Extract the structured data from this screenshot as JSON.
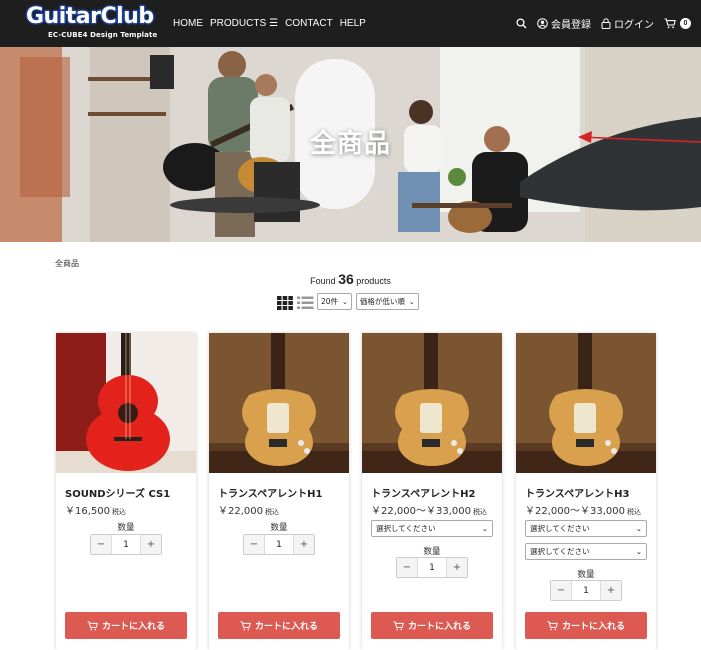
{
  "header": {
    "logo_main": "GuitarClub",
    "logo_sub": "EC-CUBE4 Design Template",
    "nav": [
      {
        "label": "HOME"
      },
      {
        "label": "PRODUCTS"
      },
      {
        "label": "CONTACT"
      },
      {
        "label": "HELP"
      }
    ],
    "register_label": "会員登録",
    "login_label": "ログイン",
    "cart_count": "0",
    "icons": {
      "search": "search-icon",
      "user": "user-icon",
      "lock": "lock-icon",
      "cart": "cart-icon",
      "menu": "hamburger-icon"
    }
  },
  "hero": {
    "title": "全商品"
  },
  "breadcrumb": "全商品",
  "results": {
    "prefix": "Found",
    "count": "36",
    "suffix": "products",
    "per_page": "20件",
    "sort": "価格が低い順"
  },
  "products": [
    {
      "name": "SOUNDシリーズ CS1",
      "price": "￥16,500",
      "tax": "税込",
      "options": [],
      "qty_label": "数量",
      "qty": "1",
      "cart_label": "カートに入れる",
      "image": "red-acoustic-guitar"
    },
    {
      "name": "トランスペアレントH1",
      "price": "￥22,000",
      "tax": "税込",
      "options": [],
      "qty_label": "数量",
      "qty": "1",
      "cart_label": "カートに入れる",
      "image": "bass-guitar"
    },
    {
      "name": "トランスペアレントH2",
      "price": "￥22,000～￥33,000",
      "tax": "税込",
      "options": [
        "選択してください"
      ],
      "qty_label": "数量",
      "qty": "1",
      "cart_label": "カートに入れる",
      "image": "bass-guitar"
    },
    {
      "name": "トランスペアレントH3",
      "price": "￥22,000～￥33,000",
      "tax": "税込",
      "options": [
        "選択してください",
        "選択してください"
      ],
      "qty_label": "数量",
      "qty": "1",
      "cart_label": "カートに入れる",
      "image": "bass-guitar"
    }
  ],
  "stepper": {
    "minus": "−",
    "plus": "+"
  },
  "colors": {
    "header_bg": "#1e1e1e",
    "cart_button": "#dd5a52",
    "logo_outline": "#1d3f96"
  }
}
